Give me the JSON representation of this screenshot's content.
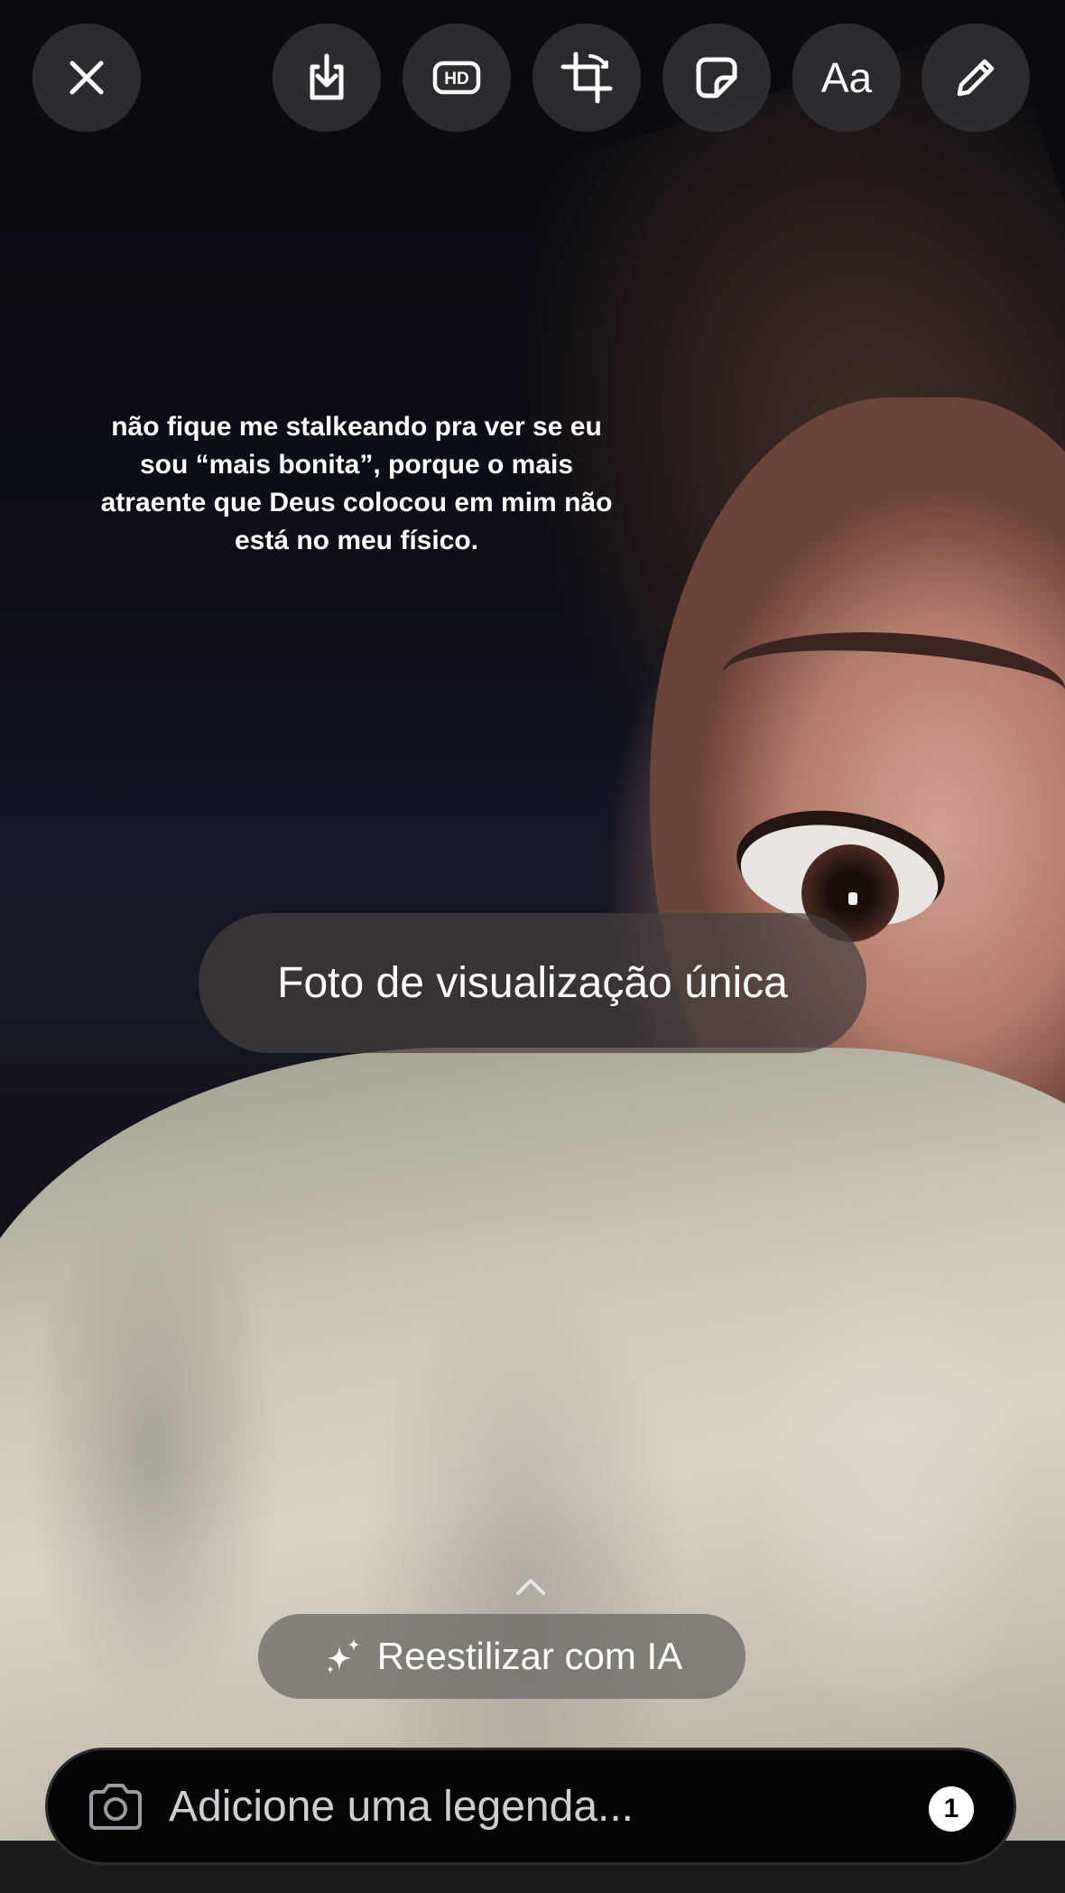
{
  "toolbar": {
    "close_icon": "close-icon",
    "download_icon": "download-icon",
    "hd_icon": "hd-icon",
    "hd_label": "HD",
    "crop_icon": "crop-icon",
    "sticker_icon": "sticker-icon",
    "text_label": "Aa",
    "draw_icon": "pencil-icon"
  },
  "story": {
    "text_lines": [
      "não fique me stalkeando pra ver se eu",
      "sou “mais bonita”, porque o mais",
      "atraente que Deus colocou em mim não",
      "está no meu físico."
    ]
  },
  "view_once": {
    "label": "Foto de visualização única"
  },
  "restyle": {
    "label": "Reestilizar com IA",
    "icon": "sparkles-icon"
  },
  "caption": {
    "placeholder": "Adicione uma legenda...",
    "count": "1",
    "camera_icon": "camera-icon"
  },
  "colors": {
    "button_bg": "#303034",
    "text": "#ffffff",
    "caption_bg": "#050506"
  }
}
